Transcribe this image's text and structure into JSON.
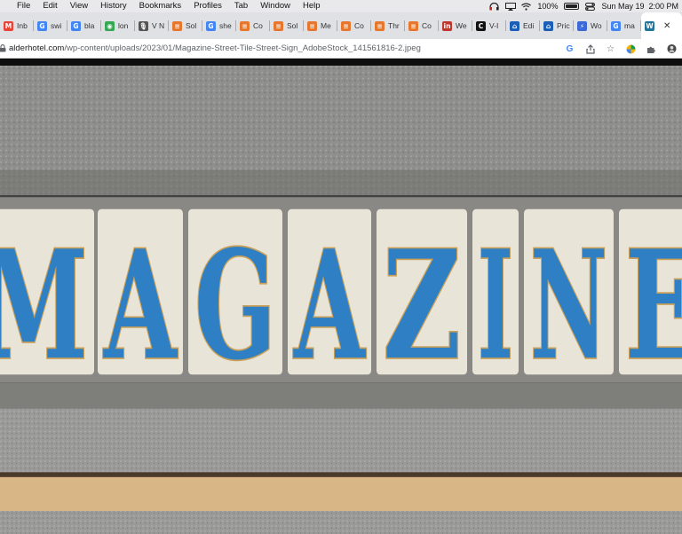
{
  "menubar": {
    "apple_icon": "apple-icon",
    "items": [
      "File",
      "Edit",
      "View",
      "History",
      "Bookmarks",
      "Profiles",
      "Tab",
      "Window",
      "Help"
    ],
    "battery": "100%",
    "datetime": "Sun May 19  2:00 PM"
  },
  "tabs": [
    {
      "label": "Inb",
      "icon": "gmail-icon",
      "color": "#ea4335",
      "glyph": "M"
    },
    {
      "label": "swi",
      "icon": "google-icon",
      "color": "#4285f4",
      "glyph": "G"
    },
    {
      "label": "bla",
      "icon": "google-icon",
      "color": "#4285f4",
      "glyph": "G"
    },
    {
      "label": "lon",
      "icon": "chrome-icon",
      "color": "#34a853",
      "glyph": "◉"
    },
    {
      "label": "V N",
      "icon": "mic-icon",
      "color": "#555555",
      "glyph": "🎙"
    },
    {
      "label": "Sol",
      "icon": "orange-site-icon",
      "color": "#e8772e",
      "glyph": "≡"
    },
    {
      "label": "she",
      "icon": "google-icon",
      "color": "#4285f4",
      "glyph": "G"
    },
    {
      "label": "Co",
      "icon": "orange-site-icon",
      "color": "#e8772e",
      "glyph": "≡"
    },
    {
      "label": "Sol",
      "icon": "orange-site-icon",
      "color": "#e8772e",
      "glyph": "≡"
    },
    {
      "label": "Me",
      "icon": "orange-site-icon",
      "color": "#e8772e",
      "glyph": "≡"
    },
    {
      "label": "Co",
      "icon": "orange-site-icon",
      "color": "#e8772e",
      "glyph": "≡"
    },
    {
      "label": "Thr",
      "icon": "orange-site-icon",
      "color": "#e8772e",
      "glyph": "≡"
    },
    {
      "label": "Co",
      "icon": "orange-site-icon",
      "color": "#e8772e",
      "glyph": "≡"
    },
    {
      "label": "We",
      "icon": "linkedin-icon",
      "color": "#c0362c",
      "glyph": "in"
    },
    {
      "label": "V-I",
      "icon": "c-site-icon",
      "color": "#111111",
      "glyph": "C"
    },
    {
      "label": "Edi",
      "icon": "zillow-icon",
      "color": "#1a5eb8",
      "glyph": "⌂"
    },
    {
      "label": "Pric",
      "icon": "zillow-icon",
      "color": "#1a5eb8",
      "glyph": "⌂"
    },
    {
      "label": "Wo",
      "icon": "bolt-icon",
      "color": "#3b6ad8",
      "glyph": "⚡"
    },
    {
      "label": "ma",
      "icon": "google-icon",
      "color": "#4285f4",
      "glyph": "G"
    },
    {
      "label": "",
      "icon": "wordpress-icon",
      "color": "#21759b",
      "glyph": "W",
      "active": true
    }
  ],
  "address": {
    "host": "alderhotel.com",
    "path": "/wp-content/uploads/2023/01/Magazine-Street-Tile-Street-Sign_AdobeStock_141561816-2.jpeg"
  },
  "image": {
    "letters": [
      "M",
      "A",
      "G",
      "A",
      "Z",
      "I",
      "N",
      "E"
    ],
    "tile_color": "#e9e4d8",
    "letter_color": "#2f7fc4",
    "outline_color": "#c9a15a",
    "concrete_color": "#8f8f8f"
  }
}
